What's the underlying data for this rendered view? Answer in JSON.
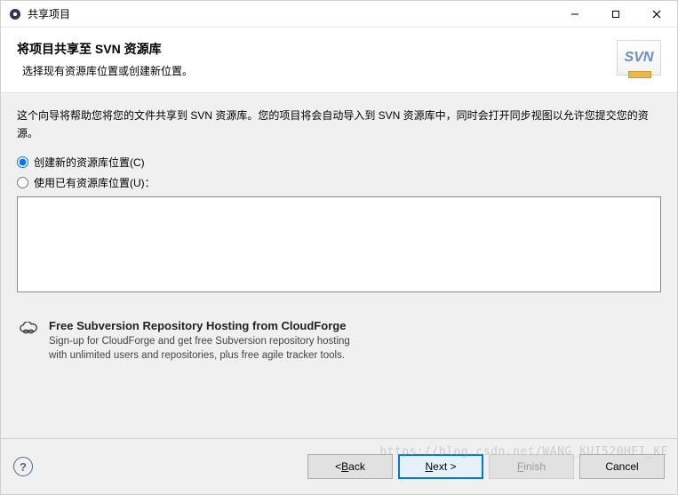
{
  "titlebar": {
    "title": "共享项目"
  },
  "header": {
    "title": "将项目共享至 SVN 资源库",
    "subtitle": "选择现有资源库位置或创建新位置。",
    "logo_text": "SVN"
  },
  "content": {
    "description": "这个向导将帮助您将您的文件共享到 SVN 资源库。您的项目将会自动导入到 SVN 资源库中，同时会打开同步视图以允许您提交您的资源。",
    "radio_create": "创建新的资源库位置(C)",
    "radio_existing": "使用已有资源库位置(U)："
  },
  "promo": {
    "title": "Free Subversion Repository Hosting from CloudForge",
    "line1": "Sign-up for CloudForge and get free Subversion repository hosting",
    "line2": "with unlimited users and repositories, plus free agile tracker tools."
  },
  "footer": {
    "back_prefix": "< ",
    "back_mn": "B",
    "back_rest": "ack",
    "next_mn": "N",
    "next_rest": "ext >",
    "finish_pre": "",
    "finish_mn": "F",
    "finish_rest": "inish",
    "cancel": "Cancel"
  },
  "watermark": "https://blog.csdn.net/WANG_KUI520HEI_KE"
}
